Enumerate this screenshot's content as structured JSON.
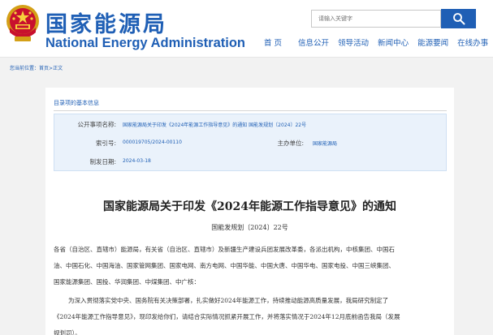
{
  "header": {
    "logo_cn": "国家能源局",
    "logo_en": "National Energy Administration",
    "search_placeholder": "请输入关键字",
    "nav": [
      {
        "label": "首 页"
      },
      {
        "label": "信息公开"
      },
      {
        "label": "领导活动"
      },
      {
        "label": "新闻中心"
      },
      {
        "label": "能源要闻"
      },
      {
        "label": "在线办事"
      }
    ]
  },
  "breadcrumb": {
    "prefix": "您当前位置：",
    "home": "首页",
    "separator": " > ",
    "current": "正文"
  },
  "catalog": {
    "heading": "目录项的基本信息",
    "rows": [
      {
        "label": "公开事项名称:",
        "value": "国家能源局关于印发《2024年能源工作指导意见》的通知 国能发规划〔2024〕22号"
      },
      {
        "label": "索引号:",
        "value": "000019705/2024-00110"
      },
      {
        "label": "主办单位:",
        "value": "国家能源局"
      },
      {
        "label": "制发日期:",
        "value": "2024-03-18"
      }
    ]
  },
  "document": {
    "title": "国家能源局关于印发《2024年能源工作指导意见》的通知",
    "number": "国能发规划〔2024〕22号",
    "lines": [
      "各省（自治区、直辖市）能源局，有关省（自治区、直辖市）及新疆生产建设兵团发展改革委，各派出机构，中核集团、中国石",
      "油、中国石化、中国海油、国家管网集团、国家电网、南方电网、中国华能、中国大唐、中国华电、国家电投、中国三峡集团、",
      "国家能源集团、国投、华润集团、中煤集团、中广核：",
      "为深入贯彻落实党中央、国务院有关决策部署，扎实做好2024年能源工作，持续推动能源高质量发展，我局研究制定了",
      "《2024年能源工作指导意见》，现印发给你们，请结合实际情况抓紧开展工作，并将落实情况于2024年12月底前函告我局（发展",
      "规划司）。"
    ]
  },
  "colors": {
    "brand_blue": "#1f5fb5",
    "table_bg": "#eaf2fb",
    "page_bg": "#f2f2f2"
  },
  "icons": {
    "emblem": "national-emblem-icon",
    "search": "search-icon"
  }
}
